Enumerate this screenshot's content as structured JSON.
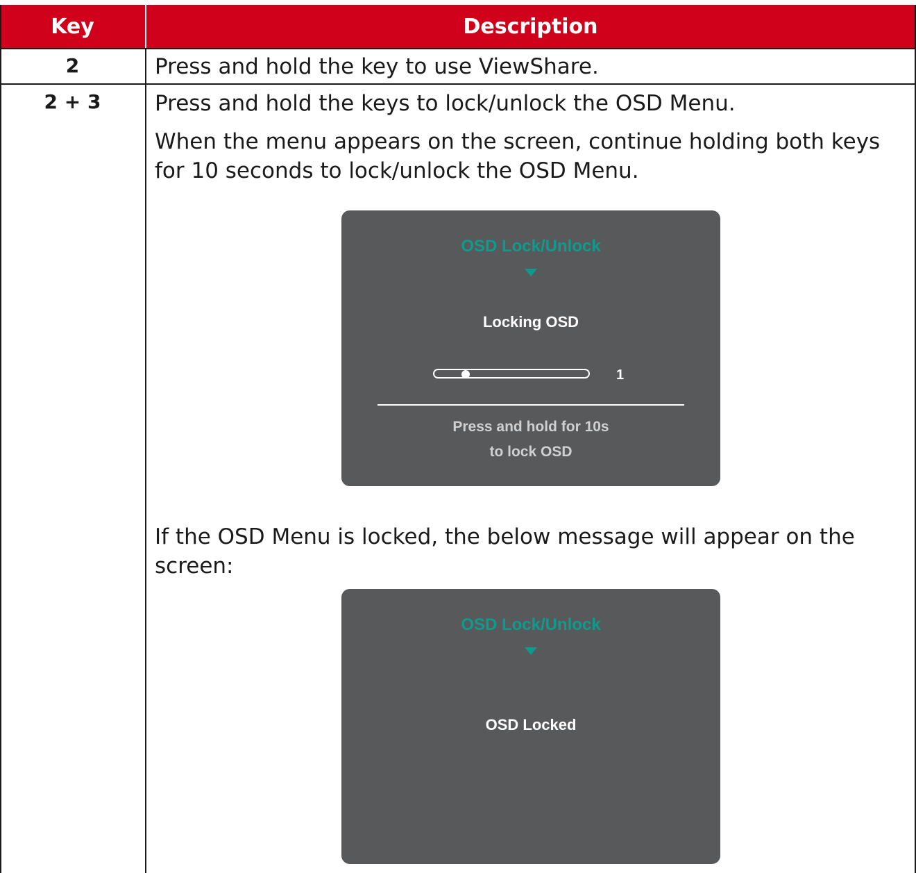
{
  "table": {
    "headers": {
      "key": "Key",
      "description": "Description"
    },
    "rows": [
      {
        "key": "2",
        "paragraphs": [
          "Press and hold the key to use ViewShare."
        ]
      },
      {
        "key": "2 + 3",
        "paragraphs": [
          "Press and hold the keys to lock/unlock the OSD Menu.",
          "When the menu appears on the screen, continue holding both keys for 10 seconds to lock/unlock the OSD Menu.",
          "If the OSD Menu is locked, the below message will appear on the screen:"
        ]
      }
    ]
  },
  "osd_locking": {
    "title": "OSD Lock/Unlock",
    "message": "Locking OSD",
    "progress_value": "1",
    "progress_fraction": 0.1,
    "hint_line1": "Press and hold for 10s",
    "hint_line2": "to lock OSD"
  },
  "osd_locked": {
    "title": "OSD Lock/Unlock",
    "message": "OSD Locked"
  },
  "colors": {
    "header_red": "#d0021b",
    "osd_background": "#58595b",
    "osd_accent": "#0e9b8d"
  }
}
